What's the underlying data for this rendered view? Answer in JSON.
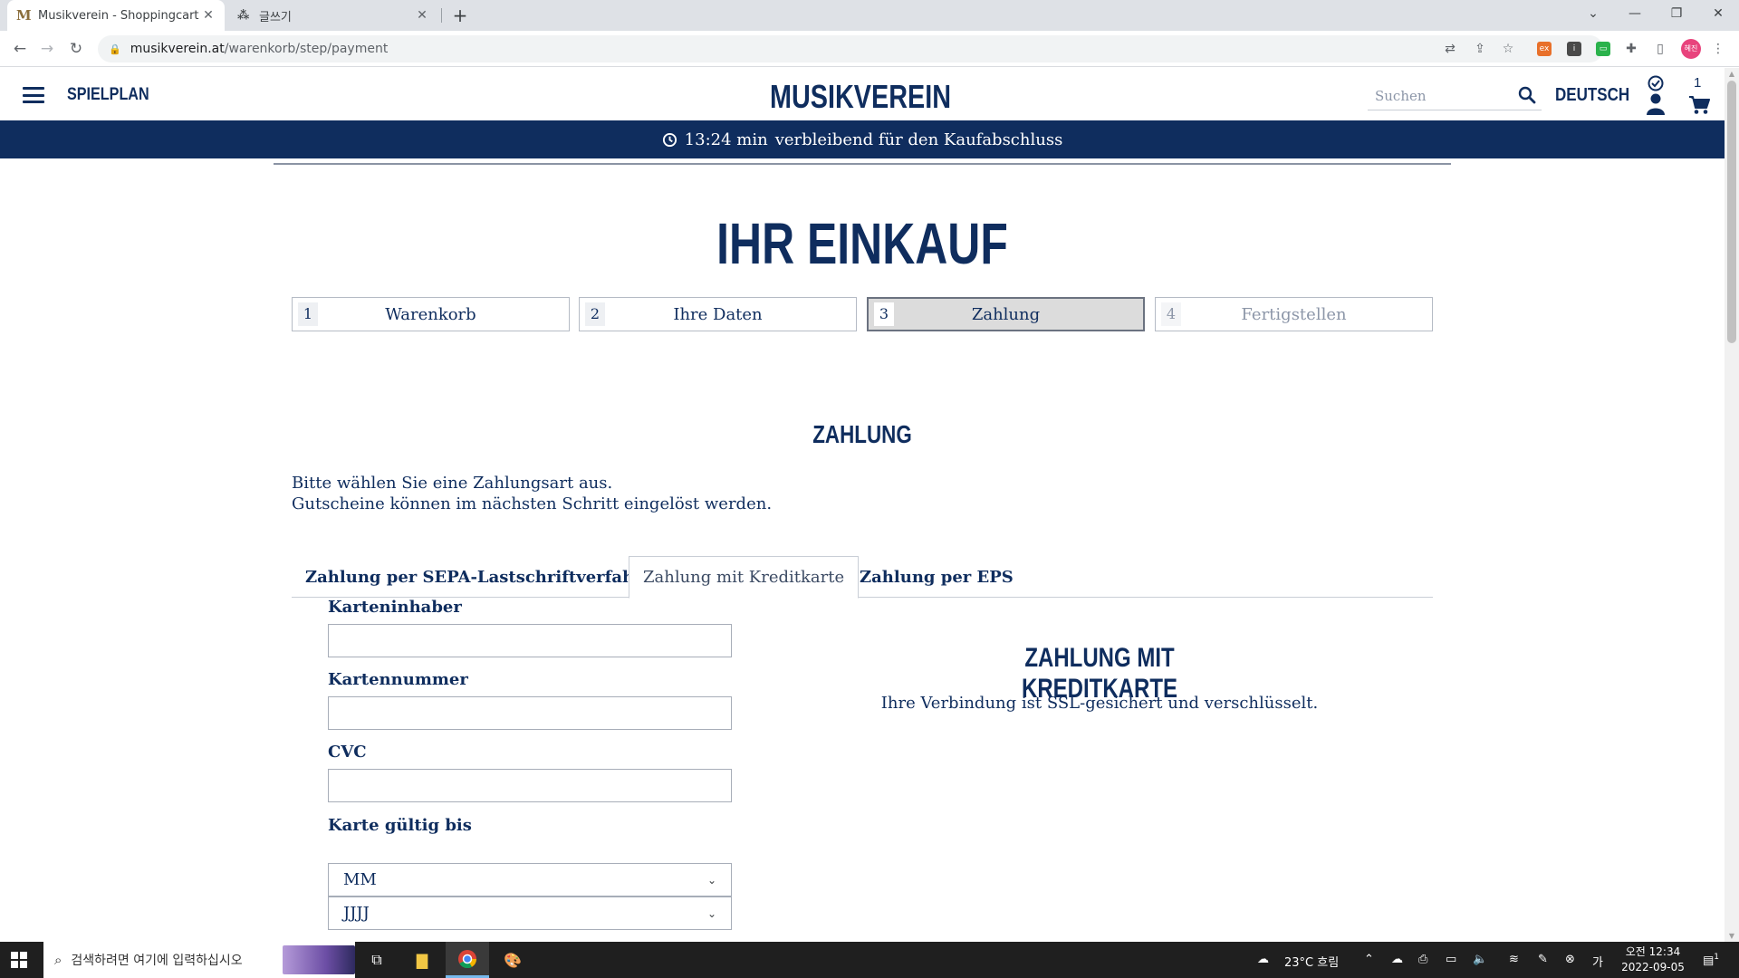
{
  "browser": {
    "tabs": [
      {
        "title": "Musikverein - Shoppingcart",
        "favicon": "M",
        "active": true
      },
      {
        "title": "글쓰기",
        "favicon": "⁂",
        "active": false
      }
    ],
    "url_host": "musikverein.at",
    "url_path": "/warenkorb/step/payment",
    "profile_label": "혜진"
  },
  "header": {
    "menu_label": "SPIELPLAN",
    "logo": "MUSIKVEREIN",
    "search_placeholder": "Suchen",
    "language": "DEUTSCH",
    "cart_count": "1"
  },
  "timer": {
    "time": "13:24 min",
    "text": "verbleibend für den Kaufabschluss"
  },
  "page": {
    "title": "IHR EINKAUF",
    "steps": [
      {
        "num": "1",
        "label": "Warenkorb",
        "state": "done"
      },
      {
        "num": "2",
        "label": "Ihre Daten",
        "state": "done"
      },
      {
        "num": "3",
        "label": "Zahlung",
        "state": "active"
      },
      {
        "num": "4",
        "label": "Fertigstellen",
        "state": "future"
      }
    ],
    "section_title": "ZAHLUNG",
    "intro_line1": "Bitte wählen Sie eine Zahlungsart aus.",
    "intro_line2": "Gutscheine können im nächsten Schritt eingelöst werden.",
    "payment_tabs": [
      {
        "label": "Zahlung per SEPA-Lastschriftverfahren*",
        "active": false
      },
      {
        "label": "Zahlung mit Kreditkarte",
        "active": true
      },
      {
        "label": "Zahlung per EPS",
        "active": false
      }
    ],
    "form": {
      "cardholder_label": "Karteninhaber",
      "cardholder_value": "",
      "cardnumber_label": "Kartennummer",
      "cardnumber_value": "",
      "cvc_label": "CVC",
      "cvc_value": "",
      "expiry_label": "Karte gültig bis",
      "month_value": "MM",
      "year_value": "JJJJ"
    },
    "cc_title": "ZAHLUNG MIT KREDITKARTE",
    "cc_text": "Ihre Verbindung ist SSL-gesichert und verschlüsselt."
  },
  "taskbar": {
    "search_placeholder": "검색하려면 여기에 입력하십시오",
    "weather": "23°C 흐림",
    "time": "오전 12:34",
    "date": "2022-09-05",
    "notification_count": "1"
  },
  "colors": {
    "brand_navy": "#0f2d5e",
    "active_step_bg": "#dcdcdc"
  }
}
